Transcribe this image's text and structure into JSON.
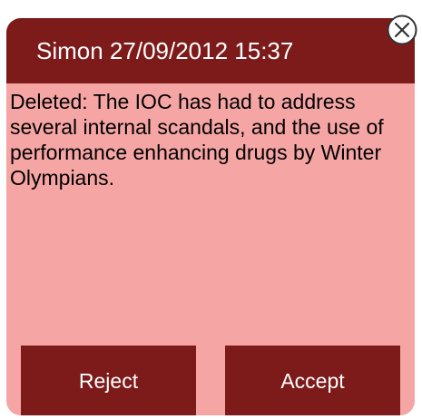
{
  "header": {
    "title": "Simon 27/09/2012 15:37"
  },
  "message": {
    "text": "Deleted: The IOC has had to address several internal scandals, and the use of performance enhancing drugs by Winter Olympians."
  },
  "actions": {
    "reject_label": "Reject",
    "accept_label": "Accept"
  },
  "icons": {
    "close": "close-icon"
  },
  "colors": {
    "header_bg": "#7d1a1a",
    "card_bg": "#f6a5a5",
    "button_bg": "#7d1a1a"
  }
}
